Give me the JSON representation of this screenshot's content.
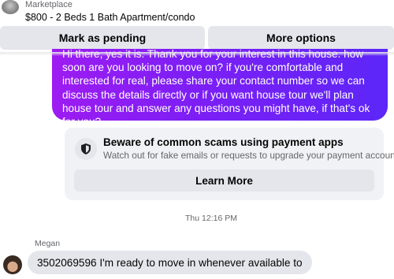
{
  "header": {
    "source": "Marketplace",
    "listing_title": "$800 - 2 Beds 1 Bath Apartment/condo"
  },
  "actions": {
    "mark_pending_label": "Mark as pending",
    "more_options_label": "More options"
  },
  "outgoing_message": {
    "text": "Hi there, yes it is. Thank you for your interest in this house. how soon are you looking to move on? if you're comfortable and interested for real, please share your contact number so we can discuss the details directly or if you want house tour we'll plan house tour and answer any questions you might have, if that's ok for you?",
    "bubble_color": "#7e1ef5"
  },
  "scam_notice": {
    "icon": "shield-icon",
    "title": "Beware of common scams using payment apps",
    "description": "Watch out for fake emails or requests to upgrade your payment account.",
    "button_label": "Learn More"
  },
  "timestamp": "Thu 12:16 PM",
  "incoming_message": {
    "sender": "Megan",
    "text": "3502069596 I'm ready to move in whenever available to"
  }
}
